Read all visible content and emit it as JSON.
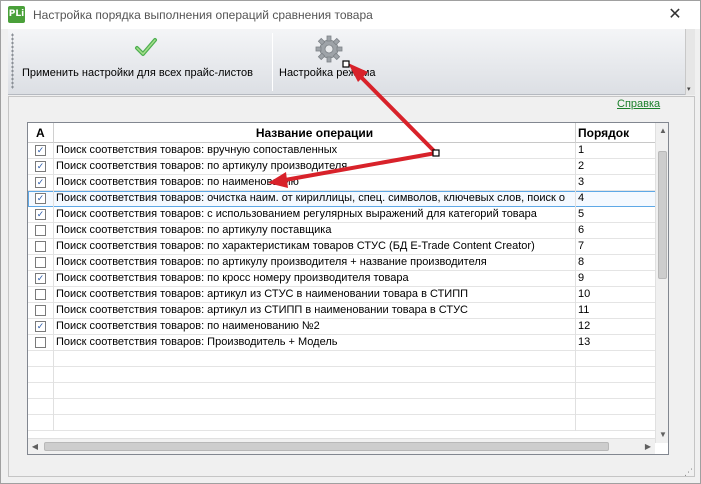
{
  "window": {
    "icon_text": "PLi",
    "title": "Настройка порядка выполнения операций сравнения товара",
    "close_symbol": "✕"
  },
  "toolbar": {
    "apply_all_label": "Применить настройки для всех прайс-листов",
    "mode_settings_label": "Настройка режима"
  },
  "help_link": "Справка",
  "grid": {
    "columns": [
      "А",
      "Название операции",
      "Порядок"
    ],
    "rows": [
      {
        "checked": true,
        "name": "Поиск соответствия товаров: вручную сопоставленных",
        "order": "1"
      },
      {
        "checked": true,
        "name": "Поиск соответствия товаров: по артикулу производителя",
        "order": "2"
      },
      {
        "checked": true,
        "name": "Поиск соответствия товаров: по наименованию",
        "order": "3"
      },
      {
        "checked": true,
        "name": "Поиск соответствия товаров: очистка наим. от кириллицы, спец. символов, ключевых слов, поиск о",
        "order": "4"
      },
      {
        "checked": true,
        "name": "Поиск соответствия товаров: с использованием регулярных выражений для категорий товара",
        "order": "5"
      },
      {
        "checked": false,
        "name": "Поиск соответствия товаров: по артикулу поставщика",
        "order": "6"
      },
      {
        "checked": false,
        "name": "Поиск соответствия товаров: по характеристикам товаров СТУС (БД E-Trade Content Creator)",
        "order": "7"
      },
      {
        "checked": false,
        "name": "Поиск соответствия товаров: по артикулу производителя + название производителя",
        "order": "8"
      },
      {
        "checked": true,
        "name": "Поиск соответствия товаров: по кросс номеру производителя товара",
        "order": "9"
      },
      {
        "checked": false,
        "name": "Поиск соответствия товаров: артикул из СТУС в наименовании товара в СТИПП",
        "order": "10"
      },
      {
        "checked": false,
        "name": "Поиск соответствия товаров: артикул из СТИПП в наименовании товара в СТУС",
        "order": "11"
      },
      {
        "checked": true,
        "name": "Поиск соответствия товаров: по наименованию №2",
        "order": "12"
      },
      {
        "checked": false,
        "name": "Поиск соответствия товаров: Производитель + Модель",
        "order": "13"
      }
    ],
    "selected_row": 4
  },
  "colors": {
    "accent_link": "#1a7f2a",
    "annotation_arrow": "#d8222a",
    "selection_border": "#5ea8e6",
    "check_icon": "#4caf50"
  }
}
